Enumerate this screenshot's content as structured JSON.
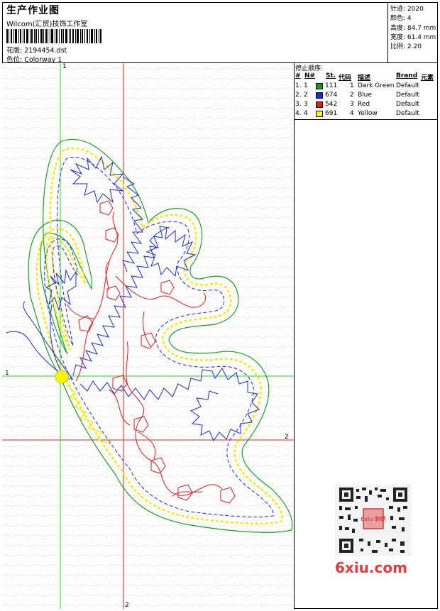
{
  "header": {
    "title": "生产作业图",
    "company": "Wilcom(汇贸)技饰工作室",
    "design_line": "花版: 2194454.dst",
    "colorway_line": "色位: Colorway 1"
  },
  "specs": [
    "针迹: 2020",
    "颜色: 4",
    "高度: 84.7 mm",
    "宽度: 61.4 mm",
    "比例: 2.20"
  ],
  "stop_sequence": {
    "title": "停止顺序:",
    "columns": [
      "#",
      "N#",
      "St.",
      "代码",
      "描述",
      "Brand",
      "元素"
    ],
    "rows": [
      {
        "index": "1.",
        "n": "1",
        "color": "#129c12",
        "stitches": "111",
        "code": "1",
        "desc": "Dark Green",
        "brand": "Default"
      },
      {
        "index": "2.",
        "n": "2",
        "color": "#1a2bd8",
        "stitches": "674",
        "code": "2",
        "desc": "Blue",
        "brand": "Default"
      },
      {
        "index": "3.",
        "n": "3",
        "color": "#e41c1c",
        "stitches": "542",
        "code": "3",
        "desc": "Red",
        "brand": "Default"
      },
      {
        "index": "4.",
        "n": "4",
        "color": "#f5f500",
        "stitches": "691",
        "code": "4",
        "desc": "Yellow",
        "brand": "Default"
      }
    ]
  },
  "guides": {
    "v1": "1",
    "h1": "1",
    "v2": "2",
    "h2": "2"
  },
  "watermark": "6xiu.com",
  "qr_text": "6xiu 刺绣"
}
